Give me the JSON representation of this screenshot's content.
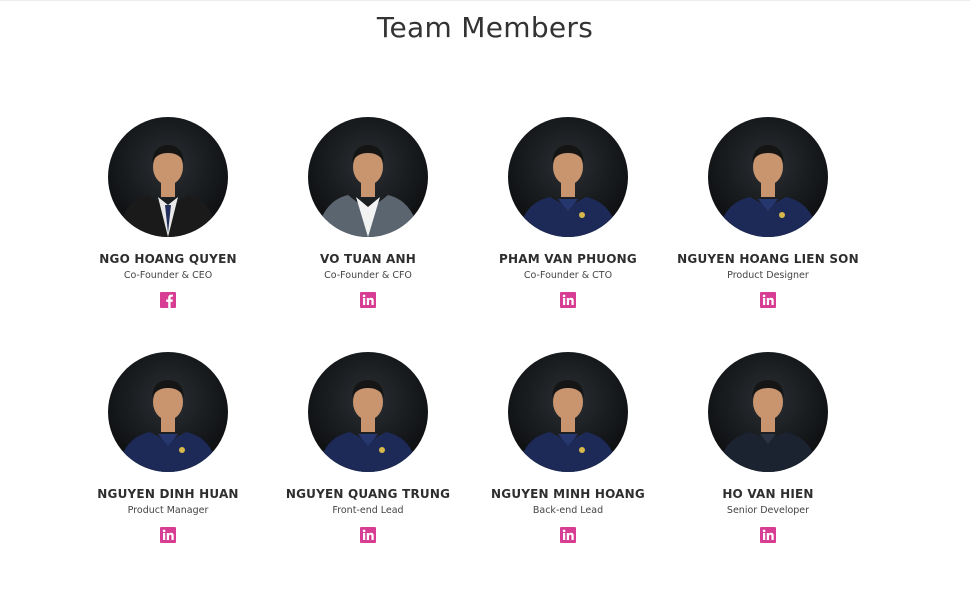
{
  "section": {
    "title": "Team Members"
  },
  "colors": {
    "accent": "#d63d93",
    "text": "#333333",
    "shirt_navy": "#1d2a57",
    "suit_dark": "#1a1a1a",
    "suit_grey": "#5b6570"
  },
  "members": [
    {
      "name": "NGO HOANG QUYEN",
      "role": "Co-Founder & CEO",
      "social": "facebook-icon",
      "outfit": "dark-suit"
    },
    {
      "name": "VO TUAN ANH",
      "role": "Co-Founder & CFO",
      "social": "linkedin-icon",
      "outfit": "grey-blazer"
    },
    {
      "name": "PHAM VAN PHUONG",
      "role": "Co-Founder & CTO",
      "social": "linkedin-icon",
      "outfit": "navy-polo"
    },
    {
      "name": "NGUYEN HOANG LIEN SON",
      "role": "Product Designer",
      "social": "linkedin-icon",
      "outfit": "navy-polo"
    },
    {
      "name": "NGUYEN DINH HUAN",
      "role": "Product Manager",
      "social": "linkedin-icon",
      "outfit": "navy-polo"
    },
    {
      "name": "NGUYEN QUANG TRUNG",
      "role": "Front-end Lead",
      "social": "linkedin-icon",
      "outfit": "navy-polo"
    },
    {
      "name": "NGUYEN MINH HOANG",
      "role": "Back-end Lead",
      "social": "linkedin-icon",
      "outfit": "navy-polo"
    },
    {
      "name": "HO VAN HIEN",
      "role": "Senior Developer",
      "social": "linkedin-icon",
      "outfit": "dark-polo"
    }
  ]
}
